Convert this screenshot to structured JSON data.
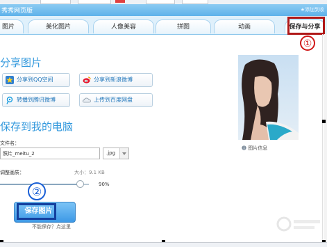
{
  "app": {
    "title": "秀秀网页版",
    "header_right": "★添加到收"
  },
  "tabs": [
    {
      "label": "图片"
    },
    {
      "label": "美化图片"
    },
    {
      "label": "人像美容"
    },
    {
      "label": "拼图"
    },
    {
      "label": "动画"
    },
    {
      "label": "保存与分享"
    }
  ],
  "markers": {
    "one": "①",
    "two": "②"
  },
  "share": {
    "heading": "分享图片",
    "buttons": [
      {
        "label": "分享到QQ空间",
        "icon": "star-icon"
      },
      {
        "label": "分享到新浪微博",
        "icon": "weibo-icon"
      },
      {
        "label": "转播到腾讯微博",
        "icon": "tencent-weibo-icon"
      },
      {
        "label": "上传到百度网盘",
        "icon": "cloud-drive-icon"
      }
    ]
  },
  "save": {
    "heading": "保存到我的电脑",
    "filename_label": "文件名：",
    "filename_value": "照片_meitu_2",
    "format_value": ".jpg",
    "quality_label": "调整画质：",
    "size_label": "大小：9.1 KB",
    "quality_value": "90%",
    "quality_fraction": 0.9,
    "save_button_label": "保存图片",
    "help_link": "不能保存？点这里"
  },
  "photo": {
    "info_label": "图片信息"
  },
  "colors": {
    "accent": "#3399dd",
    "callout_red": "#b01818",
    "callout_blue": "#133f9e"
  }
}
